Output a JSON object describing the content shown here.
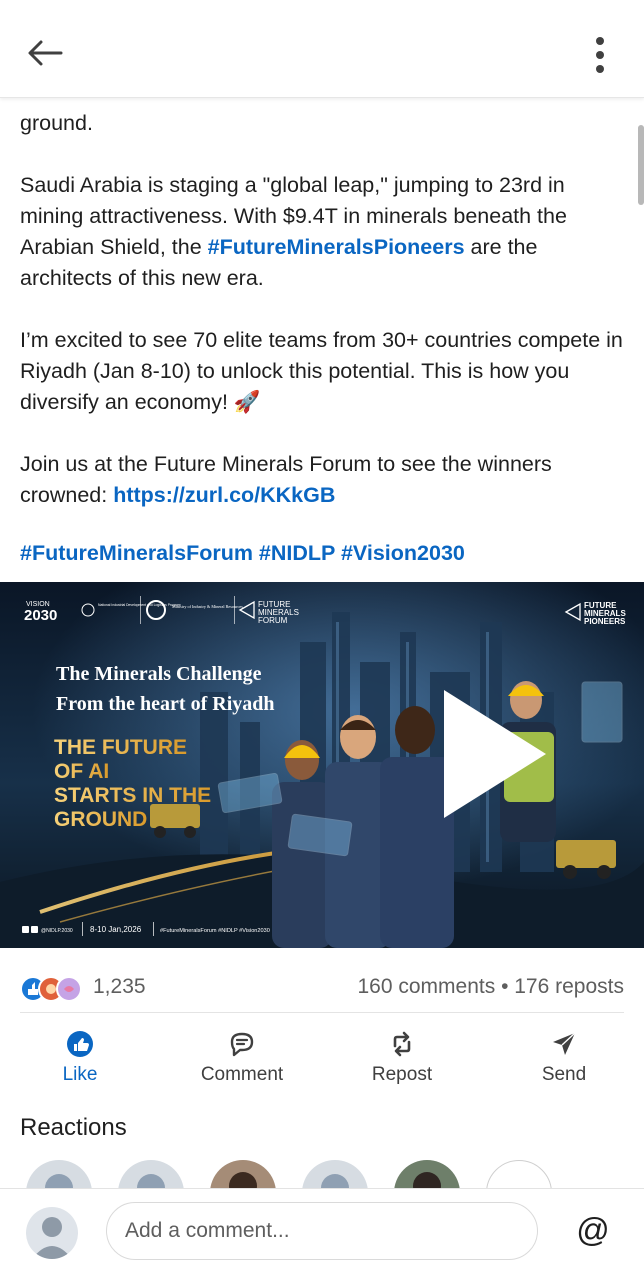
{
  "post": {
    "partial_line": "ground.",
    "paragraph1": {
      "pre": "Saudi Arabia is staging a \"global leap,\" jumping to 23rd in mining attractiveness. With $9.4T in minerals beneath the Arabian Shield, the ",
      "hashtag": "#FutureMineralsPioneers",
      "post": " are the architects of this new era."
    },
    "paragraph2": "I’m excited to see 70 elite teams from 30+ countries compete in Riyadh (Jan 8-10) to unlock this potential. This is how you diversify an economy! 🚀",
    "paragraph3": {
      "pre": "Join us at the Future Minerals Forum to see the winners crowned: ",
      "link": "https://zurl.co/KKkGB"
    },
    "hashtags": "#FutureMineralsForum #NIDLP #Vision2030"
  },
  "media": {
    "vision_label": "VISION",
    "vision_year": "2030",
    "program_name": "National Industrial Development and Logistics Program",
    "ministry_name": "Ministry of Industry & Mineral Resources",
    "forum_logo": [
      "FUTURE",
      "MINERALS",
      "FORUM"
    ],
    "pioneers_logo": [
      "FUTURE",
      "MINERALS",
      "PIONEERS"
    ],
    "headline1": "The Minerals Challenge",
    "headline2": "From the heart of Riyadh",
    "tagline": [
      "THE FUTURE",
      "OF AI",
      "STARTS IN THE",
      "GROUND"
    ],
    "footer_handle": "@NIDLP.2030",
    "footer_dates": "8-10 Jan,2026",
    "footer_tags": "#FutureMineralsForum #NIDLP #Vision2030"
  },
  "stats": {
    "reactions_count": "1,235",
    "engagement": "160 comments • 176 reposts"
  },
  "actions": {
    "like": "Like",
    "comment": "Comment",
    "repost": "Repost",
    "send": "Send"
  },
  "reactions_section": {
    "title": "Reactions"
  },
  "comment_box": {
    "placeholder": "Add a comment...",
    "mention": "@"
  },
  "colors": {
    "link": "#0a66c2",
    "text": "#1f1f1f",
    "muted": "#5e5e5e",
    "reaction_like": "#1a78d6",
    "reaction_celebrate": "#e0613a",
    "reaction_support": "#c5a3e6"
  },
  "icons": {
    "back": "arrow-left-icon",
    "more": "vertical-dots-icon",
    "play": "play-icon",
    "like": "thumbs-up-icon",
    "comment": "speech-bubble-icon",
    "repost": "repost-arrows-icon",
    "send": "paper-plane-icon"
  }
}
